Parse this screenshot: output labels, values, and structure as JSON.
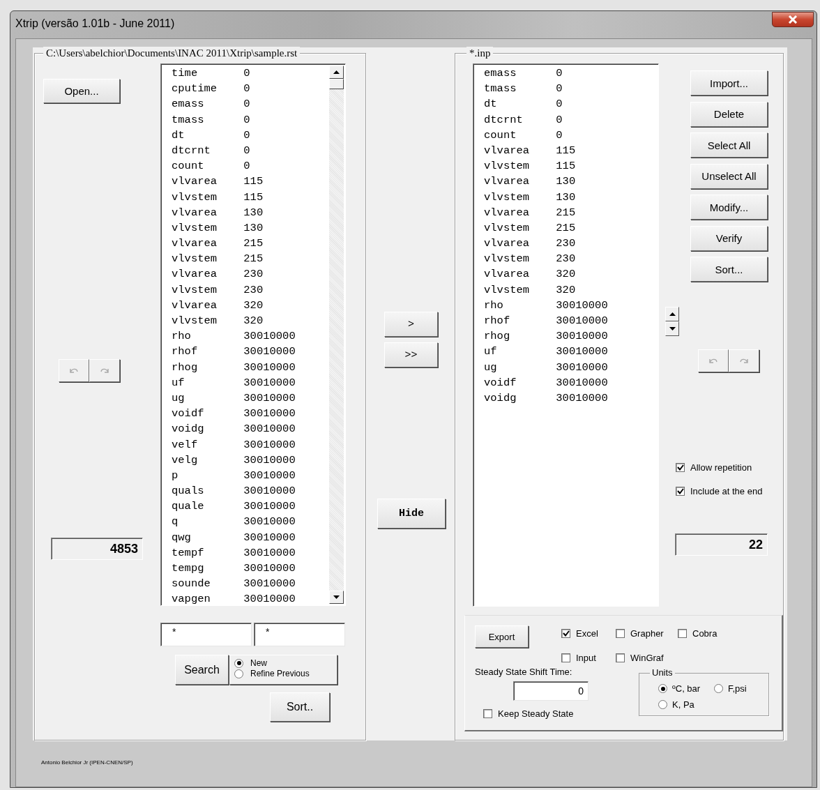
{
  "window": {
    "title": "Xtrip (versão 1.01b - June 2011)"
  },
  "source_panel": {
    "title": "C:\\Users\\abelchior\\Documents\\INAC 2011\\Xtrip\\sample.rst",
    "open_button": "Open...",
    "history_buttons": [
      {
        "kind": "undo",
        "disabled": true
      },
      {
        "kind": "redo",
        "disabled": true
      }
    ],
    "count": "4853",
    "variables": [
      {
        "name": "time",
        "value": "0"
      },
      {
        "name": "cputime",
        "value": "0"
      },
      {
        "name": "emass",
        "value": "0"
      },
      {
        "name": "tmass",
        "value": "0"
      },
      {
        "name": "dt",
        "value": "0"
      },
      {
        "name": "dtcrnt",
        "value": "0"
      },
      {
        "name": "count",
        "value": "0"
      },
      {
        "name": "vlvarea",
        "value": "115"
      },
      {
        "name": "vlvstem",
        "value": "115"
      },
      {
        "name": "vlvarea",
        "value": "130"
      },
      {
        "name": "vlvstem",
        "value": "130"
      },
      {
        "name": "vlvarea",
        "value": "215"
      },
      {
        "name": "vlvstem",
        "value": "215"
      },
      {
        "name": "vlvarea",
        "value": "230"
      },
      {
        "name": "vlvstem",
        "value": "230"
      },
      {
        "name": "vlvarea",
        "value": "320"
      },
      {
        "name": "vlvstem",
        "value": "320"
      },
      {
        "name": "rho",
        "value": "30010000"
      },
      {
        "name": "rhof",
        "value": "30010000"
      },
      {
        "name": "rhog",
        "value": "30010000"
      },
      {
        "name": "uf",
        "value": "30010000"
      },
      {
        "name": "ug",
        "value": "30010000"
      },
      {
        "name": "voidf",
        "value": "30010000"
      },
      {
        "name": "voidg",
        "value": "30010000"
      },
      {
        "name": "velf",
        "value": "30010000"
      },
      {
        "name": "velg",
        "value": "30010000"
      },
      {
        "name": "p",
        "value": "30010000"
      },
      {
        "name": "quals",
        "value": "30010000"
      },
      {
        "name": "quale",
        "value": "30010000"
      },
      {
        "name": "q",
        "value": "30010000"
      },
      {
        "name": "qwg",
        "value": "30010000"
      },
      {
        "name": "tempf",
        "value": "30010000"
      },
      {
        "name": "tempg",
        "value": "30010000"
      },
      {
        "name": "sounde",
        "value": "30010000"
      },
      {
        "name": "vapgen",
        "value": "30010000"
      }
    ],
    "filters": [
      "*",
      "*"
    ],
    "search_button": "Search",
    "search_modes": [
      {
        "label": "New",
        "selected": true
      },
      {
        "label": "Refine Previous",
        "selected": false
      }
    ],
    "sort_button": "Sort.."
  },
  "transfer_buttons": [
    ">",
    ">>"
  ],
  "hide_button": "Hide",
  "target_panel": {
    "title": "*.inp",
    "variables": [
      {
        "name": "emass",
        "value": "0"
      },
      {
        "name": "tmass",
        "value": "0"
      },
      {
        "name": "dt",
        "value": "0"
      },
      {
        "name": "dtcrnt",
        "value": "0"
      },
      {
        "name": "count",
        "value": "0"
      },
      {
        "name": "vlvarea",
        "value": "115"
      },
      {
        "name": "vlvstem",
        "value": "115"
      },
      {
        "name": "vlvarea",
        "value": "130"
      },
      {
        "name": "vlvstem",
        "value": "130"
      },
      {
        "name": "vlvarea",
        "value": "215"
      },
      {
        "name": "vlvstem",
        "value": "215"
      },
      {
        "name": "vlvarea",
        "value": "230"
      },
      {
        "name": "vlvstem",
        "value": "230"
      },
      {
        "name": "vlvarea",
        "value": "320"
      },
      {
        "name": "vlvstem",
        "value": "320"
      },
      {
        "name": "rho",
        "value": "30010000"
      },
      {
        "name": "rhof",
        "value": "30010000"
      },
      {
        "name": "rhog",
        "value": "30010000"
      },
      {
        "name": "uf",
        "value": "30010000"
      },
      {
        "name": "ug",
        "value": "30010000"
      },
      {
        "name": "voidf",
        "value": "30010000"
      },
      {
        "name": "voidg",
        "value": "30010000"
      }
    ],
    "buttons": [
      "Import...",
      "Delete",
      "Select All",
      "Unselect All",
      "Modify...",
      "Verify",
      "Sort..."
    ],
    "history_buttons": [
      {
        "kind": "undo",
        "disabled": true
      },
      {
        "kind": "redo",
        "disabled": true
      }
    ],
    "options": [
      {
        "label": "Allow repetition",
        "checked": true
      },
      {
        "label": "Include at the end",
        "checked": true
      }
    ],
    "count": "22",
    "export": {
      "button": "Export",
      "formats": [
        {
          "label": "Excel",
          "checked": true
        },
        {
          "label": "Grapher",
          "checked": false
        },
        {
          "label": "Cobra",
          "checked": false
        },
        {
          "label": "Input",
          "checked": false
        },
        {
          "label": "WinGraf",
          "checked": false
        }
      ],
      "shift_label": "Steady State Shift Time:",
      "shift_value": "0",
      "keep_steady_state": {
        "label": "Keep Steady State",
        "checked": false
      },
      "units": {
        "title": "Units",
        "options": [
          {
            "label": "ºC, bar",
            "selected": true
          },
          {
            "label": "F,psi",
            "selected": false
          },
          {
            "label": "K, Pa",
            "selected": false
          }
        ]
      }
    }
  },
  "footer": "Antonio Belchior Jr (IPEN-CNEN/SP)"
}
